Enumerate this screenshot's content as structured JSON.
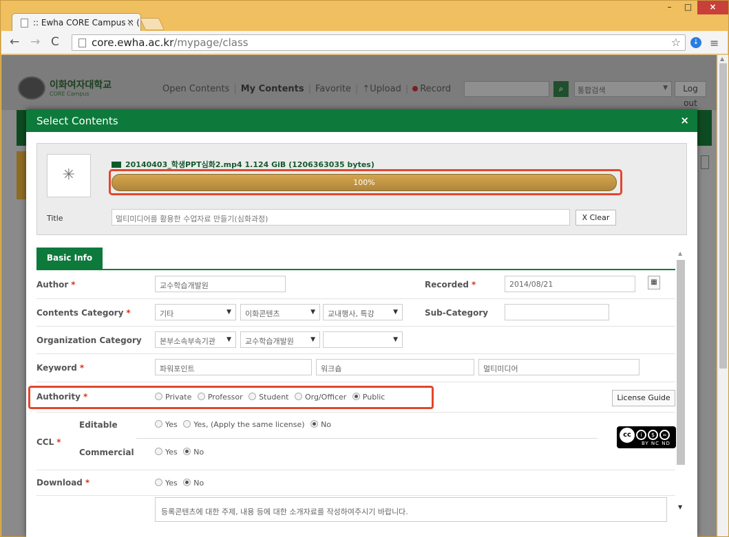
{
  "browser": {
    "tab_title": ":: Ewha CORE Campus :: (",
    "tab_close": "×",
    "url_host": "core.ewha.ac.kr",
    "url_path": "/mypage/class",
    "min": "–",
    "max": "□",
    "close": "×"
  },
  "site": {
    "logo_text": "이화여자대학교",
    "logo_sub": "CORE Campus",
    "nav": {
      "open_contents": "Open Contents",
      "my_contents": "My Contents",
      "favorite": "Favorite",
      "upload": "Upload",
      "record": "Record"
    },
    "search_select": "통합검색",
    "logout": "Log out"
  },
  "dialog": {
    "title": "Select Contents",
    "close": "×",
    "file_info": "20140403_학생PPT심화2.mp4  1.124 GiB (1206363035 bytes)",
    "progress_text": "100%",
    "progress_value": 1.0,
    "title_label": "Title",
    "title_value": "멀티미디어를 활용한 수업자료 만들기(심화과정)",
    "clear_label": "X Clear",
    "tab_basic": "Basic Info",
    "author_label": "Author",
    "author_value": "교수학습개발원",
    "recorded_label": "Recorded",
    "recorded_value": "2014/08/21",
    "category_label": "Contents Category",
    "category_1": "기타",
    "category_2": "이화콘텐츠",
    "category_3": "교내행사, 특강",
    "subcategory_label": "Sub-Category",
    "org_label": "Organization Category",
    "org_1": "본부소속부속기관",
    "org_2": "교수학습개발원",
    "keyword_label": "Keyword",
    "keyword_1": "파워포인트",
    "keyword_2": "워크숍",
    "keyword_3": "멀티미디어",
    "authority_label": "Authority",
    "authority_options": [
      "Private",
      "Professor",
      "Student",
      "Org/Officer",
      "Public"
    ],
    "license_guide": "License Guide",
    "ccl_label": "CCL",
    "editable_label": "Editable",
    "editable_options": [
      "Yes",
      "Yes, (Apply the same license)",
      "No"
    ],
    "commercial_label": "Commercial",
    "commercial_options": [
      "Yes",
      "No"
    ],
    "download_label": "Download",
    "download_options": [
      "Yes",
      "No"
    ],
    "description_value": "등록콘텐츠에 대한 주제, 내용 등에 대한 소개자료를 작성하여주시기 바랍니다.",
    "cc_sub": "BY NC ND"
  }
}
